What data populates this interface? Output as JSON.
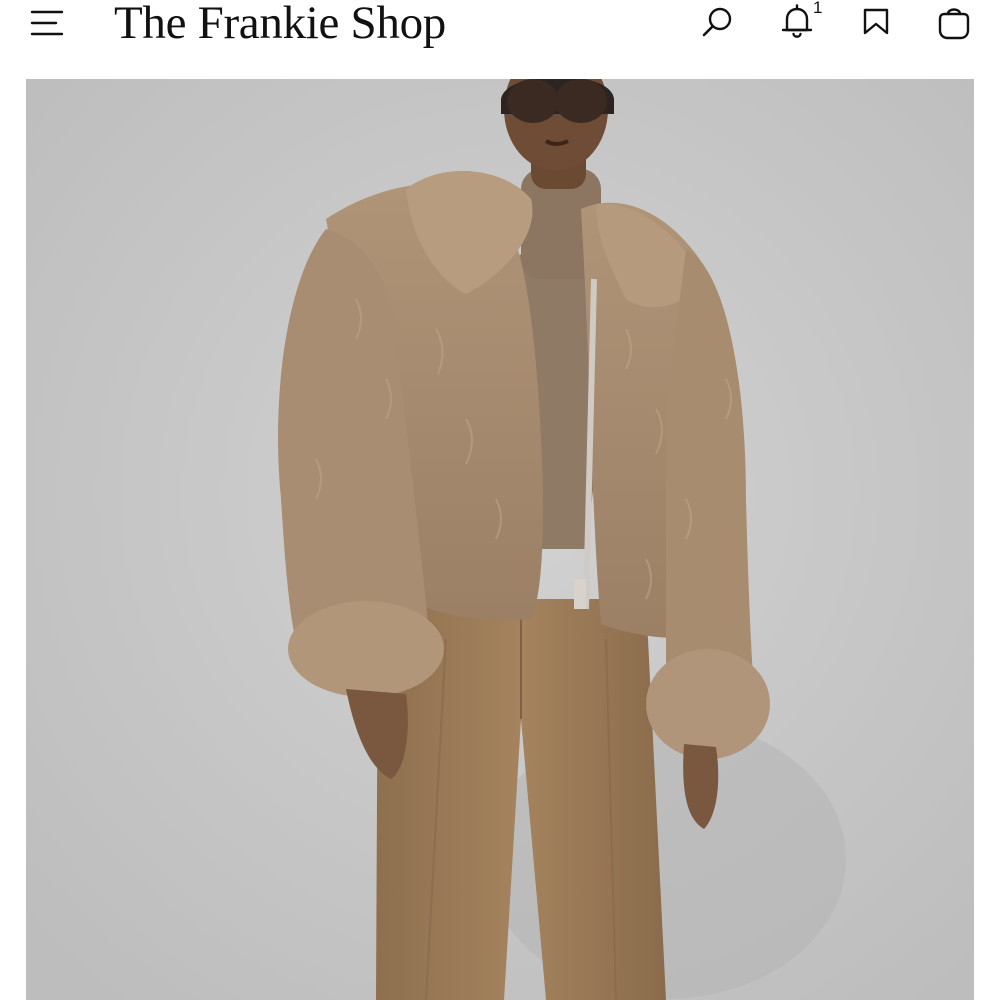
{
  "header": {
    "brand": "The Frankie Shop",
    "menu_icon": "hamburger-menu-icon",
    "search_icon": "search-icon",
    "notifications_icon": "bell-icon",
    "notification_count": "1",
    "saved_icon": "bookmark-icon",
    "bag_icon": "shopping-bag-icon"
  },
  "product_image": {
    "alt": "Model wearing a cropped faux fur jacket, turtleneck sweater and pleated trousers"
  },
  "colors": {
    "text": "#111111",
    "background": "#ffffff",
    "photo_background": "#c6c6c6",
    "fur": "#a58a70",
    "trousers": "#9a7a56"
  }
}
